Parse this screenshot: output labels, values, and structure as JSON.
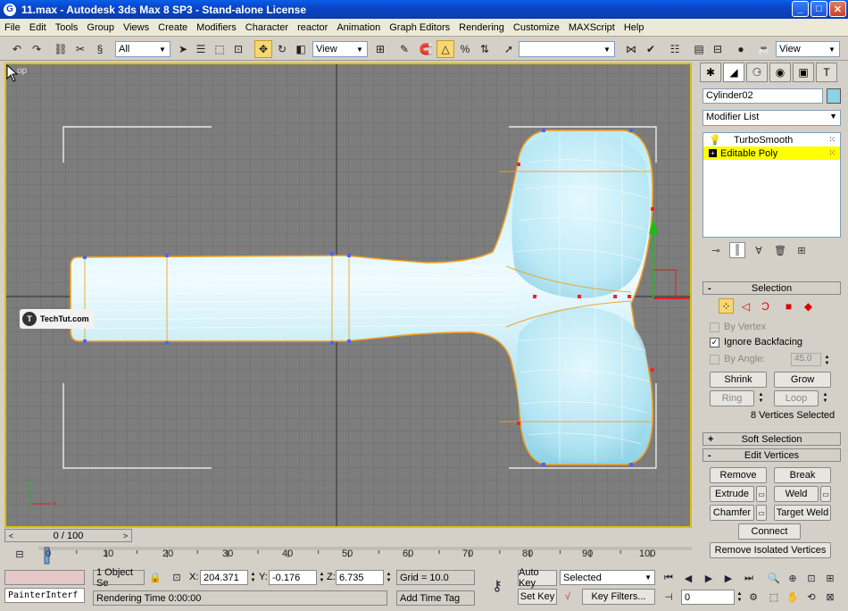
{
  "titlebar": {
    "title": "11.max - Autodesk 3ds Max 8 SP3  - Stand-alone License",
    "minimize": "_",
    "maximize": "□",
    "close": "✕"
  },
  "menu": [
    "File",
    "Edit",
    "Tools",
    "Group",
    "Views",
    "Create",
    "Modifiers",
    "Character",
    "reactor",
    "Animation",
    "Graph Editors",
    "Rendering",
    "Customize",
    "MAXScript",
    "Help"
  ],
  "toolbar": {
    "selection_filter": "All",
    "ref_coord": "View",
    "named_sel": "",
    "view_right": "View"
  },
  "viewport": {
    "label": "op",
    "watermark": "TechTut.com",
    "axis_x": "x",
    "axis_y": "y"
  },
  "command_panel": {
    "object_name": "Cylinder02",
    "object_color": "#8cd2e6",
    "modifier_list": "Modifier List",
    "stack": [
      {
        "label": "TurboSmooth",
        "selected": false
      },
      {
        "label": "Editable Poly",
        "selected": true
      }
    ],
    "selection": {
      "title": "Selection",
      "by_vertex": "By Vertex",
      "ignore_backfacing": "Ignore Backfacing",
      "by_angle": "By Angle:",
      "angle_value": "45.0",
      "shrink": "Shrink",
      "grow": "Grow",
      "ring": "Ring",
      "loop": "Loop",
      "status": "8 Vertices Selected"
    },
    "soft_selection": "Soft Selection",
    "edit_vertices": {
      "title": "Edit Vertices",
      "remove": "Remove",
      "break": "Break",
      "extrude": "Extrude",
      "weld": "Weld",
      "chamfer": "Chamfer",
      "target_weld": "Target Weld",
      "connect": "Connect",
      "remove_isolated": "Remove Isolated Vertices"
    }
  },
  "timeline": {
    "slider": "0 / 100",
    "ticks": [
      "0",
      "10",
      "20",
      "30",
      "40",
      "50",
      "60",
      "70",
      "80",
      "90",
      "100"
    ]
  },
  "status": {
    "maxscript": "PainterInterf",
    "selection_count": "1 Object Se",
    "x_label": "X:",
    "x_value": "204.371",
    "y_label": "Y:",
    "y_value": "-0.176",
    "z_label": "Z:",
    "z_value": "6.735",
    "grid": "Grid = 10.0",
    "rendering_time": "Rendering Time  0:00:00",
    "add_time_tag": "Add Time Tag",
    "auto_key": "Auto Key",
    "set_key": "Set Key",
    "key_mode": "Selected",
    "key_filters": "Key Filters...",
    "frame": "0"
  }
}
